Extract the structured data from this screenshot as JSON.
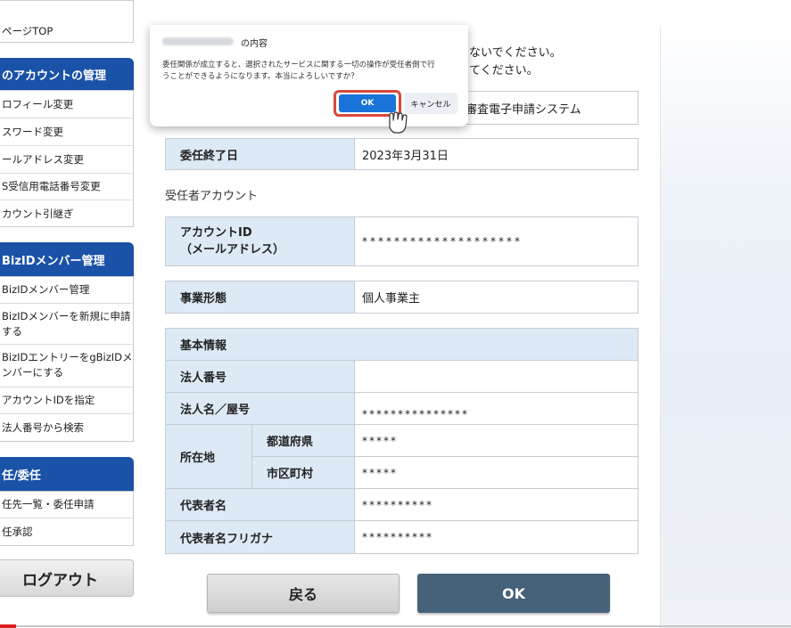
{
  "sidebar": {
    "top_link": "ページTOP",
    "sections": [
      {
        "title": "のアカウントの管理",
        "items": [
          "ロフィール変更",
          "スワード変更",
          "ールアドレス変更",
          "S受信用電話番号変更",
          "カウント引継ぎ"
        ]
      },
      {
        "title": "BizIDメンバー管理",
        "items": [
          "BizIDメンバー管理",
          "BizIDメンバーを新規に申請する",
          "BizIDエントリーをgBizIDメンバーにする",
          "アカウントIDを指定",
          "法人番号から検索"
        ]
      },
      {
        "title": "任/委任",
        "items": [
          "任先一覧・委任申請",
          "任承認"
        ]
      }
    ],
    "logout": "ログアウト"
  },
  "notice": {
    "line1": "ないでください。",
    "line2": "てください。"
  },
  "rows": {
    "system_value": "審査電子申請システム",
    "end_date_label": "委任終了日",
    "end_date_value": "2023年3月31日",
    "delegatee_section": "受任者アカウント",
    "account_id_label_1": "アカウントID",
    "account_id_label_2": "（メールアドレス）",
    "account_id_value": "********************",
    "business_type_label": "事業形態",
    "business_type_value": "個人事業主"
  },
  "basic_info": {
    "header": "基本情報",
    "corp_number_label": "法人番号",
    "corp_number_value": "",
    "corp_name_label": "法人名／屋号",
    "corp_name_value": "***************",
    "address_label": "所在地",
    "prefecture_label": "都道府県",
    "prefecture_value": "*****",
    "city_label": "市区町村",
    "city_value": "*****",
    "rep_name_label": "代表者名",
    "rep_name_value": "**********",
    "rep_kana_label": "代表者名フリガナ",
    "rep_kana_value": "**********"
  },
  "buttons": {
    "back": "戻る",
    "ok": "OK"
  },
  "dialog": {
    "title_suffix": "の内容",
    "message_line1": "委任関係が成立すると、選択されたサービスに関する一切の操作が受任者側で行",
    "message_line2": "うことができるようになります。本当によろしいですか？",
    "ok": "OK",
    "cancel": "キャンセル"
  },
  "colors": {
    "sidebar_header": "#1a52a7",
    "label_bg": "#dde9f4",
    "primary_button": "#466278",
    "dialog_ok": "#1a73d8",
    "dialog_ok_highlight": "#d9483b"
  },
  "icons": [
    "mouse-pointer-icon"
  ]
}
